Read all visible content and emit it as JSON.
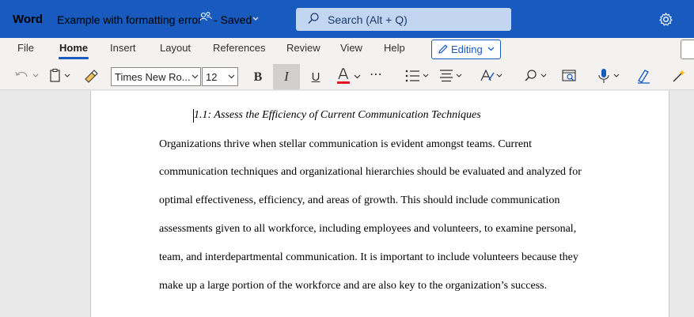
{
  "titlebar": {
    "app_name": "Word",
    "doc_title": "Example with formatting error",
    "save_status": "- Saved",
    "search_placeholder": "Search (Alt + Q)",
    "bg_color": "#185abd"
  },
  "tabs": [
    {
      "label": "File"
    },
    {
      "label": "Home",
      "active": true
    },
    {
      "label": "Insert"
    },
    {
      "label": "Layout"
    },
    {
      "label": "References"
    },
    {
      "label": "Review"
    },
    {
      "label": "View"
    },
    {
      "label": "Help"
    }
  ],
  "mode_button": {
    "label": "Editing",
    "icon": "pencil-icon"
  },
  "toolbar": {
    "font_name": "Times New Ro...",
    "font_size": "12",
    "bold": "B",
    "italic": "I",
    "underline": "U",
    "font_color_glyph": "A",
    "font_color": "#e81123",
    "more": "⋯",
    "icons": [
      "undo-icon",
      "clipboard-icon",
      "format-painter-icon",
      "bullets-icon",
      "align-icon",
      "styles-icon",
      "find-icon",
      "view-icon",
      "dictate-icon",
      "editor-icon",
      "designer-icon"
    ]
  },
  "document": {
    "heading": "1.1: Assess the Efficiency of Current Communication Techniques",
    "lines": [
      "Organizations thrive when stellar communication is evident amongst teams. Current",
      "communication techniques and organizational hierarchies should be evaluated and analyzed for",
      "optimal effectiveness, efficiency, and areas of growth. This should include communication",
      "assessments given to all workforce, including employees and volunteers, to examine personal,",
      "team, and interdepartmental communication. It is important to include volunteers because they",
      "make up a large portion of the workforce and are also key to the organization’s success."
    ]
  }
}
